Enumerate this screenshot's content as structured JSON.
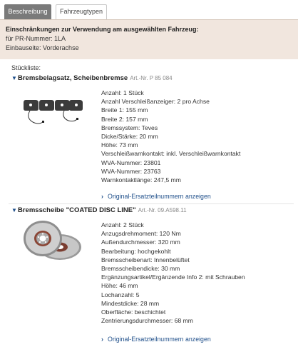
{
  "tabs": [
    {
      "label": "Beschreibung"
    },
    {
      "label": "Fahrzeugtypen"
    }
  ],
  "restrictions": {
    "title": "Einschränkungen zur Verwendung am ausgewählten Fahrzeug:",
    "lines": [
      "für PR-Nummer: 1LA",
      "Einbauseite: Vorderachse"
    ]
  },
  "stueckliste_label": "Stückliste:",
  "items": [
    {
      "name": "Bremsbelagsatz, Scheibenbremse",
      "artnr": "Art.-Nr. P 85 084",
      "properties": [
        "Anzahl: 1 Stück",
        "Anzahl Verschleißanzeiger: 2 pro Achse",
        "Breite 1: 155 mm",
        "Breite 2: 157 mm",
        "Bremssystem: Teves",
        "Dicke/Stärke: 20 mm",
        "Höhe: 73 mm",
        "Verschleißwarnkontakt: inkl. Verschleißwarnkontakt",
        "WVA-Nummer: 23801",
        "WVA-Nummer: 23763",
        "Warnkontaktlänge: 247,5 mm"
      ],
      "link": "Original-Ersatzteilnummern anzeigen"
    },
    {
      "name": "Bremsscheibe \"COATED DISC LINE\"",
      "artnr": "Art.-Nr. 09.A598.11",
      "properties": [
        "Anzahl: 2 Stück",
        "Anzugsdrehmoment: 120 Nm",
        "Außendurchmesser: 320 mm",
        "Bearbeitung: hochgekohlt",
        "Bremsscheibenart: Innenbelüftet",
        "Bremsscheibendicke: 30 mm",
        "Ergänzungsartikel/Ergänzende Info 2: mit Schrauben",
        "Höhe: 46 mm",
        "Lochanzahl: 5",
        "Mindestdicke: 28 mm",
        "Oberfläche: beschichtet",
        "Zentrierungsdurchmesser: 68 mm"
      ],
      "link": "Original-Ersatzteilnummern anzeigen"
    }
  ],
  "colors": {
    "active_tab": "#7a7a7a",
    "restriction_bg": "#f1e6de",
    "link": "#1f4f8a"
  },
  "icons": {
    "expand": "chevron-down-icon",
    "link_arrow": "chevron-right-icon"
  }
}
